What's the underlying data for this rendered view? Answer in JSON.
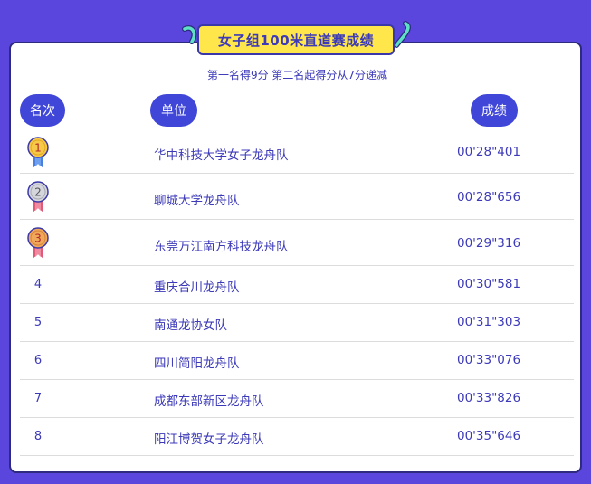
{
  "title": "女子组100米直道赛成绩",
  "subtitle": "第一名得9分 第二名起得分从7分递减",
  "headers": {
    "rank": "名次",
    "unit": "单位",
    "score": "成绩"
  },
  "colors": {
    "background": "#5a46dc",
    "title_badge": "#ffe64a",
    "accent": "#3f46d8",
    "text": "#3c3ab8",
    "gold": "#f7c948",
    "silver": "#c9c9cf",
    "bronze": "#f0a85a"
  },
  "rows": [
    {
      "rank": "1",
      "unit": "华中科技大学女子龙舟队",
      "score": "00'28\"401",
      "medal": "gold-medal-icon"
    },
    {
      "rank": "2",
      "unit": "聊城大学龙舟队",
      "score": "00'28\"656",
      "medal": "silver-medal-icon"
    },
    {
      "rank": "3",
      "unit": "东莞万江南方科技龙舟队",
      "score": "00'29\"316",
      "medal": "bronze-medal-icon"
    },
    {
      "rank": "4",
      "unit": "重庆合川龙舟队",
      "score": "00'30\"581"
    },
    {
      "rank": "5",
      "unit": "南通龙协女队",
      "score": "00'31\"303"
    },
    {
      "rank": "6",
      "unit": "四川简阳龙舟队",
      "score": "00'33\"076"
    },
    {
      "rank": "7",
      "unit": "成都东部新区龙舟队",
      "score": "00'33\"826"
    },
    {
      "rank": "8",
      "unit": "阳江博贺女子龙舟队",
      "score": "00'35\"646"
    }
  ]
}
